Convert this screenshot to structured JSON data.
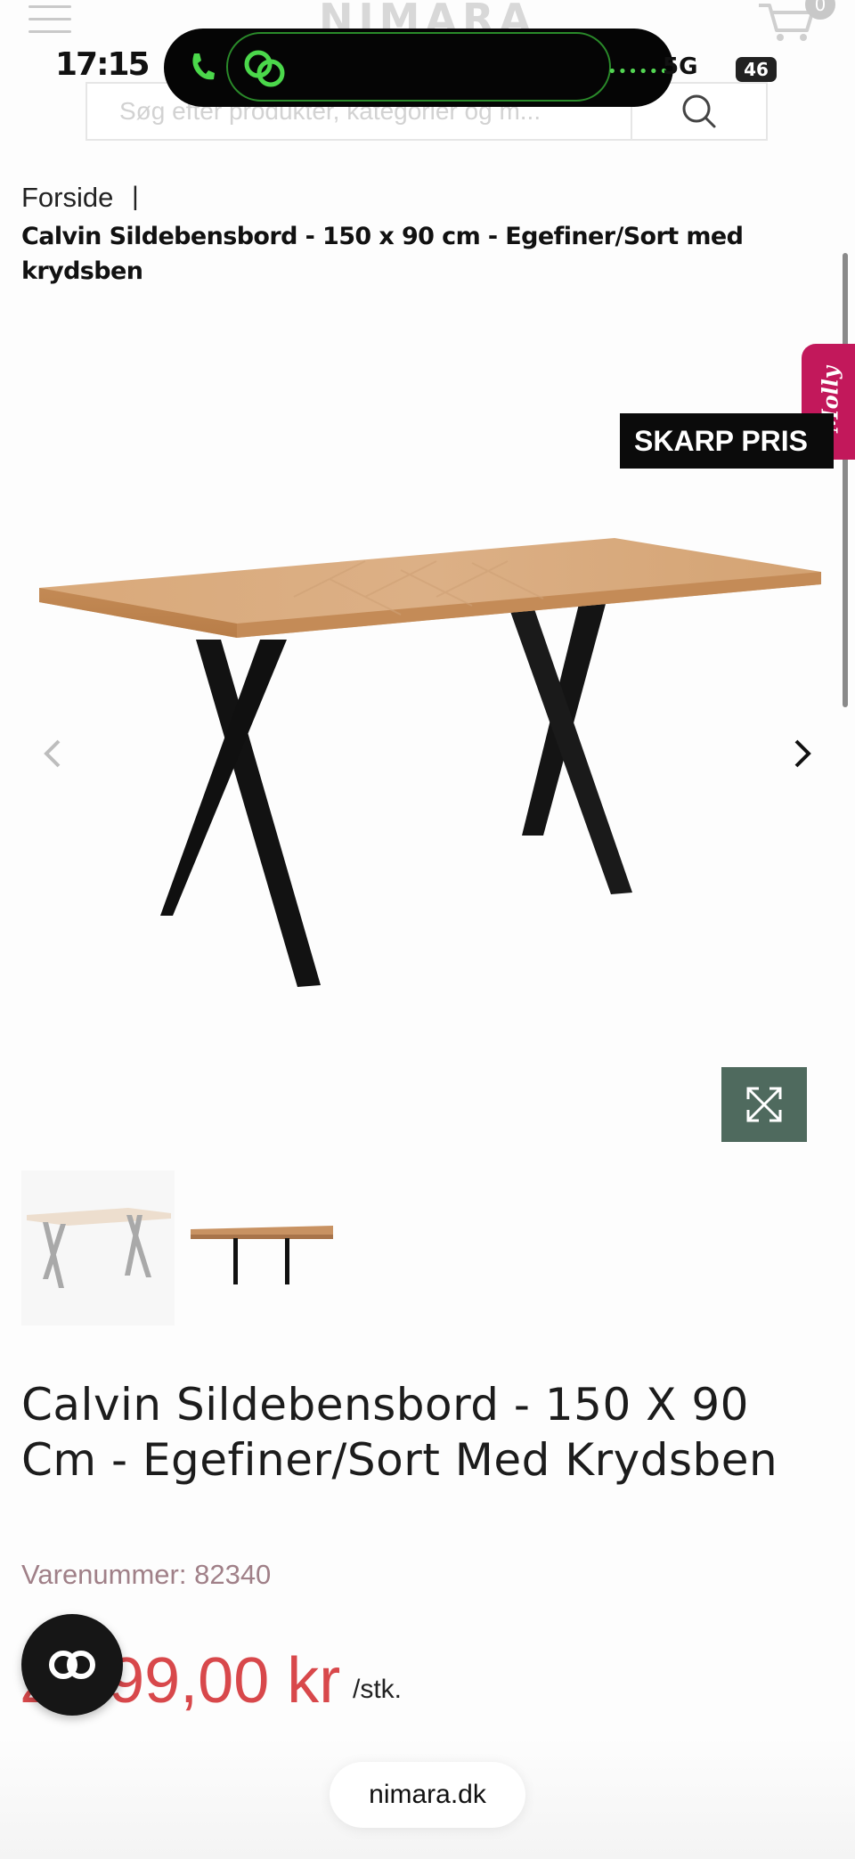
{
  "status_bar": {
    "time": "17:15",
    "network": "5G",
    "battery": "46"
  },
  "header": {
    "logo": "NIMARA",
    "cart_count": "0",
    "search_placeholder": "Søg efter produkter, kategorier og m..."
  },
  "breadcrumb": {
    "home": "Forside",
    "separator": "|",
    "current": "Calvin Sildebensbord - 150 x 90 cm - Egefiner/Sort med krydsben"
  },
  "side_tab": {
    "label": "Molly",
    "color": "#c2185b"
  },
  "badge": {
    "label": "SKARP PRIS"
  },
  "product": {
    "title": "Calvin Sildebensbord - 150 X 90 Cm - Egefiner/Sort Med Krydsben",
    "sku": "Varenummer: 82340",
    "price": "2.099,00 kr",
    "unit": "/stk."
  },
  "colors": {
    "price": "#d8484b",
    "zoom_button": "#4f6a5e",
    "sku": "#a08088"
  },
  "icons": [
    "menu-icon",
    "cart-icon",
    "search-icon",
    "phone-icon",
    "chevron-left-icon",
    "chevron-right-icon",
    "expand-icon",
    "chat-icon"
  ],
  "browser": {
    "url": "nimara.dk"
  }
}
